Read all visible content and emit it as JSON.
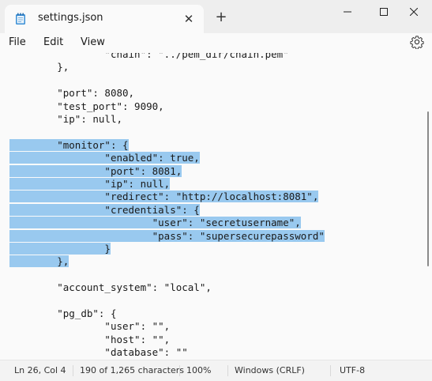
{
  "window": {
    "tab_title": "settings.json",
    "tab_icon": "notepad-icon",
    "close_tab_glyph": "✕",
    "new_tab_glyph": "+"
  },
  "menu": {
    "items": [
      "File",
      "Edit",
      "View"
    ]
  },
  "editor": {
    "selection_color": "#99c9ef",
    "lines": [
      {
        "indent": "                ",
        "text": "\"chain\": \"../pem_dir/chain.pem\"",
        "selected": false
      },
      {
        "indent": "        ",
        "text": "},",
        "selected": false
      },
      {
        "indent": "",
        "text": "",
        "selected": false
      },
      {
        "indent": "        ",
        "text": "\"port\": 8080,",
        "selected": false
      },
      {
        "indent": "        ",
        "text": "\"test_port\": 9090,",
        "selected": false
      },
      {
        "indent": "        ",
        "text": "\"ip\": null,",
        "selected": false
      },
      {
        "indent": "",
        "text": "",
        "selected": false
      },
      {
        "indent": "        ",
        "text": "\"monitor\": {",
        "selected": true
      },
      {
        "indent": "                ",
        "text": "\"enabled\": true,",
        "selected": true
      },
      {
        "indent": "                ",
        "text": "\"port\": 8081,",
        "selected": true
      },
      {
        "indent": "                ",
        "text": "\"ip\": null,",
        "selected": true
      },
      {
        "indent": "                ",
        "text": "\"redirect\": \"http://localhost:8081\",",
        "selected": true
      },
      {
        "indent": "                ",
        "text": "\"credentials\": {",
        "selected": true
      },
      {
        "indent": "                        ",
        "text": "\"user\": \"secretusername\",",
        "selected": true
      },
      {
        "indent": "                        ",
        "text": "\"pass\": \"supersecurepassword\"",
        "selected": true
      },
      {
        "indent": "                ",
        "text": "}",
        "selected": true
      },
      {
        "indent": "        ",
        "text": "},",
        "selected": true
      },
      {
        "indent": "",
        "text": "",
        "selected": false
      },
      {
        "indent": "        ",
        "text": "\"account_system\": \"local\",",
        "selected": false
      },
      {
        "indent": "",
        "text": "",
        "selected": false
      },
      {
        "indent": "        ",
        "text": "\"pg_db\": {",
        "selected": false
      },
      {
        "indent": "                ",
        "text": "\"user\": \"\",",
        "selected": false
      },
      {
        "indent": "                ",
        "text": "\"host\": \"\",",
        "selected": false
      },
      {
        "indent": "                ",
        "text": "\"database\": \"\"",
        "selected": false
      }
    ]
  },
  "status": {
    "position": "Ln 26, Col 4",
    "selection": "190 of 1,265 characters",
    "zoom": "100%",
    "line_ending": "Windows (CRLF)",
    "encoding": "UTF-8"
  }
}
